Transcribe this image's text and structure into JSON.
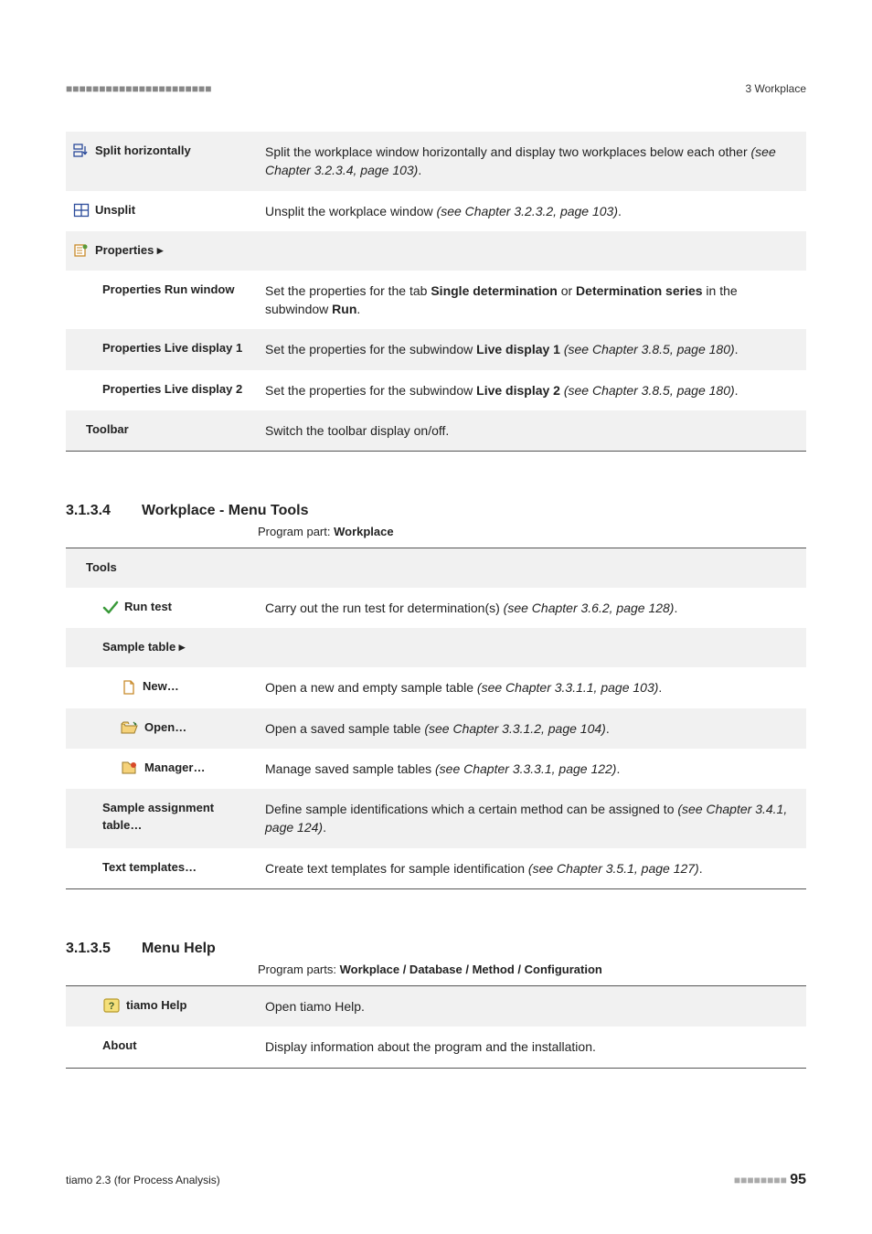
{
  "header": {
    "dashes": "■■■■■■■■■■■■■■■■■■■■■■",
    "chapter": "3 Workplace"
  },
  "view_rows": [
    {
      "key": "split_h",
      "label": "Split horizontally",
      "icon": "split-h-icon",
      "indent": "",
      "shade": true,
      "desc_plain": "Split the workplace window horizontally and display two workplaces below each other ",
      "desc_ital": "(see Chapter 3.2.3.4, page 103)",
      "desc_tail": "."
    },
    {
      "key": "unsplit",
      "label": "Unsplit",
      "icon": "unsplit-icon",
      "indent": "",
      "desc_plain": "Unsplit the workplace window ",
      "desc_ital": "(see Chapter 3.2.3.2, page 103)",
      "desc_tail": "."
    },
    {
      "key": "props",
      "label": "Properties ▸",
      "icon": "properties-icon",
      "indent": "",
      "shade": true,
      "desc_plain": "",
      "desc_ital": "",
      "desc_tail": ""
    },
    {
      "key": "props_run",
      "label": "Properties Run window",
      "indent": "sub1",
      "desc_html": "Set the properties for the tab <span class='bd'>Single determination</span> or <span class='bd'>Determination series</span> in the subwindow <span class='bd'>Run</span>."
    },
    {
      "key": "props_l1",
      "label": "Properties Live display 1",
      "indent": "sub1",
      "shade": true,
      "desc_html": "Set the properties for the subwindow <span class='bd'>Live display 1</span> <span class='itl'>(see Chapter 3.8.5, page 180)</span>."
    },
    {
      "key": "props_l2",
      "label": "Properties Live display 2",
      "indent": "sub1",
      "desc_html": "Set the properties for the subwindow <span class='bd'>Live display 2</span> <span class='itl'>(see Chapter 3.8.5, page 180)</span>."
    },
    {
      "key": "toolbar",
      "label": "Toolbar",
      "indent": "sub1s",
      "shade": true,
      "divider": true,
      "desc_plain": "Switch the toolbar display on/off.",
      "desc_ital": "",
      "desc_tail": ""
    }
  ],
  "section_tools": {
    "num": "3.1.3.4",
    "title": "Workplace - Menu Tools",
    "sub_prefix": "Program part: ",
    "sub_bold": "Workplace"
  },
  "tools_rows": [
    {
      "key": "tools_hdr",
      "label": "Tools",
      "indent": "sub1s",
      "shade": true,
      "desc_plain": "",
      "desc_ital": "",
      "desc_tail": ""
    },
    {
      "key": "runtest",
      "label": "Run test",
      "icon": "check-icon",
      "indent": "sub1i",
      "desc_plain": "Carry out the run test for determination(s) ",
      "desc_ital": "(see Chapter 3.6.2, page 128)",
      "desc_tail": "."
    },
    {
      "key": "sample_table",
      "label": "Sample table ▸",
      "indent": "sub1",
      "shade": true,
      "desc_plain": "",
      "desc_ital": "",
      "desc_tail": ""
    },
    {
      "key": "new",
      "label": "New…",
      "icon": "new-doc-icon",
      "indent": "sub2i",
      "desc_plain": "Open a new and empty sample table ",
      "desc_ital": "(see Chapter 3.3.1.1, page 103)",
      "desc_tail": "."
    },
    {
      "key": "open",
      "label": "Open…",
      "icon": "open-folder-icon",
      "indent": "sub2i",
      "shade": true,
      "desc_plain": "Open a saved sample table ",
      "desc_ital": "(see Chapter 3.3.1.2, page 104)",
      "desc_tail": "."
    },
    {
      "key": "manager",
      "label": "Manager…",
      "icon": "manager-icon",
      "indent": "sub2i",
      "desc_plain": "Manage saved sample tables ",
      "desc_ital": "(see Chapter 3.3.3.1, page 122)",
      "desc_tail": "."
    },
    {
      "key": "sample_assign",
      "label": "Sample assignment table…",
      "indent": "sub1",
      "shade": true,
      "desc_plain": "Define sample identifications which a certain method can be assigned to ",
      "desc_ital": "(see Chapter 3.4.1, page 124)",
      "desc_tail": "."
    },
    {
      "key": "text_templates",
      "label": "Text templates…",
      "indent": "sub1",
      "divider": true,
      "desc_plain": "Create text templates for sample identification ",
      "desc_ital": "(see Chapter 3.5.1, page 127)",
      "desc_tail": "."
    }
  ],
  "section_help": {
    "num": "3.1.3.5",
    "title": "Menu Help",
    "sub_prefix": "Program parts: ",
    "sub_bold": "Workplace / Database / Method / Configuration"
  },
  "help_rows": [
    {
      "key": "tiamo_help",
      "label": "tiamo Help",
      "icon": "help-icon",
      "indent": "sub1i",
      "shade": true,
      "desc_plain": "Open tiamo Help.",
      "desc_ital": "",
      "desc_tail": ""
    },
    {
      "key": "about",
      "label": "About",
      "indent": "sub1",
      "divider": true,
      "desc_plain": "Display information about the program and the installation.",
      "desc_ital": "",
      "desc_tail": ""
    }
  ],
  "footer": {
    "left": "tiamo 2.3 (for Process Analysis)",
    "dashes": "■■■■■■■■",
    "page": "95"
  }
}
